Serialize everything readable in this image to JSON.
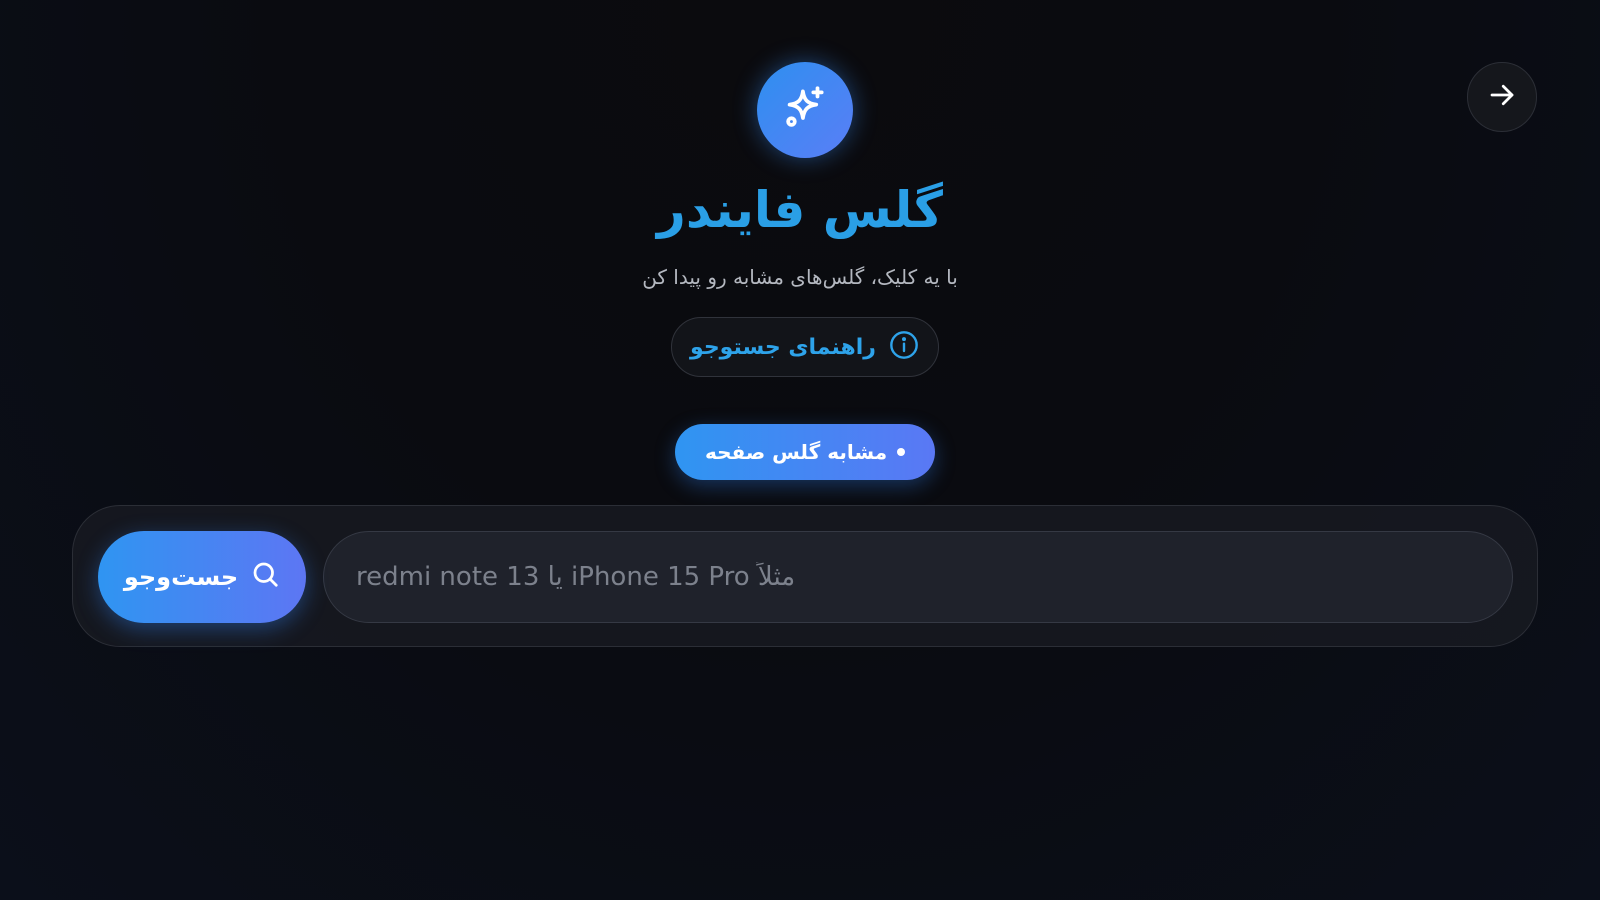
{
  "header": {
    "back_icon": "arrow-right-icon",
    "logo_icon": "sparkles-icon"
  },
  "hero": {
    "title": "گلس فایندر",
    "subtitle": "با یه کلیک، گلس‌های مشابه رو پیدا کن",
    "guide_button_label": "راهنمای جستوجو",
    "guide_icon": "info-icon"
  },
  "chip": {
    "label": "مشابه گلس صفحه"
  },
  "search": {
    "placeholder": "مثلاً iPhone 15 Pro یا redmi note 13",
    "value": "",
    "button_label": "جست‌وجو",
    "button_icon": "search-icon"
  },
  "colors": {
    "accent": "#2a9fe6",
    "gradient_start": "#2f95f2",
    "gradient_end": "#5a78f4",
    "background": "#0a0b10"
  }
}
